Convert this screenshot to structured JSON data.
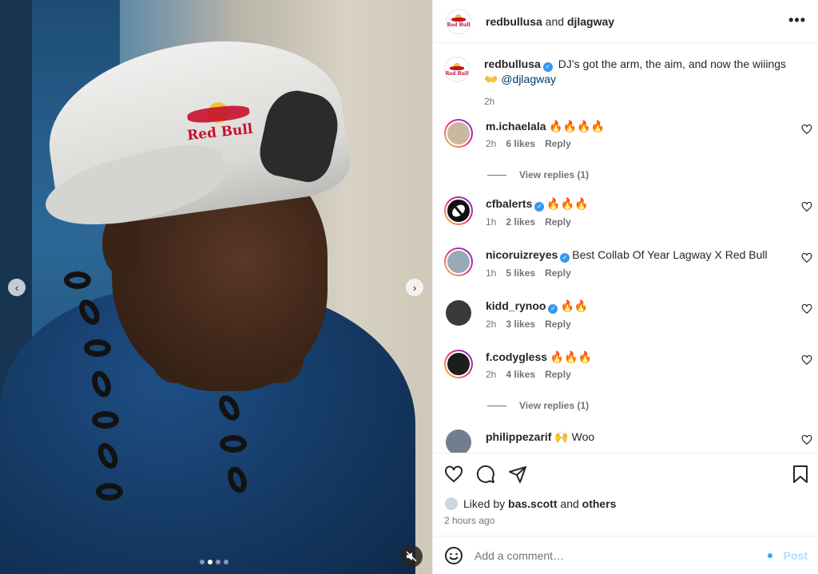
{
  "media": {
    "logo_text": "Red Bull",
    "prev_glyph": "‹",
    "next_glyph": "›",
    "carousel_count": 4,
    "carousel_active": 2
  },
  "header": {
    "account1": "redbullusa",
    "joiner": " and ",
    "account2": "djlagway",
    "more_glyph": "•••"
  },
  "caption": {
    "username": "redbullusa",
    "verified": true,
    "text": "DJ’s got the arm, the aim, and now the wiiings",
    "emoji": "👐",
    "mention": "@djlagway",
    "time": "2h"
  },
  "comments": [
    {
      "username": "m.ichaelala",
      "verified": false,
      "text": "🔥🔥🔥🔥",
      "time": "2h",
      "likes": "6 likes",
      "reply": "Reply",
      "view_replies": "View replies (1)",
      "avatar_color": "#c9b8a0",
      "ring": true
    },
    {
      "username": "cfbalerts",
      "verified": true,
      "text": "🔥🔥🔥",
      "time": "1h",
      "likes": "2 likes",
      "reply": "Reply",
      "avatar_color": "#111111",
      "ring": true
    },
    {
      "username": "nicoruizreyes",
      "verified": true,
      "text": "Best Collab Of Year Lagway X Red Bull",
      "time": "1h",
      "likes": "5 likes",
      "reply": "Reply",
      "avatar_color": "#9aa9b8",
      "ring": true
    },
    {
      "username": "kidd_rynoo",
      "verified": true,
      "text": "🔥🔥",
      "time": "2h",
      "likes": "3 likes",
      "reply": "Reply",
      "avatar_color": "#3a3a3a",
      "ring": false
    },
    {
      "username": "f.codygless",
      "verified": false,
      "text": "🔥🔥🔥",
      "time": "2h",
      "likes": "4 likes",
      "reply": "Reply",
      "view_replies": "View replies (1)",
      "avatar_color": "#1d1d1d",
      "ring": true
    },
    {
      "username": "philippezarif",
      "verified": false,
      "text": "🙌 Woo",
      "time": "",
      "likes": "",
      "reply": "",
      "avatar_color": "#6f7f8d",
      "ring": false
    }
  ],
  "actions": {
    "liked_prefix": "Liked by ",
    "liked_user": "bas.scott",
    "liked_joiner": " and ",
    "liked_others": "others",
    "timestamp": "2 hours ago"
  },
  "composer": {
    "placeholder": "Add a comment…",
    "post_label": "Post"
  },
  "colors": {
    "link": "#00376b",
    "verified": "#3897f0",
    "post_disabled": "#b3dbff"
  }
}
